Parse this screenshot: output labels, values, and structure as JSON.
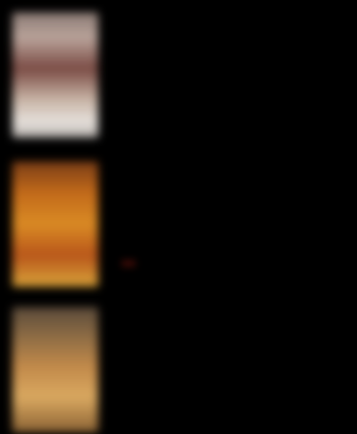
{
  "items": [
    {
      "title": "",
      "subtitle": "",
      "badge": "",
      "meta": ""
    },
    {
      "title": "",
      "subtitle": "",
      "badge": "",
      "meta": ""
    },
    {
      "title": "",
      "subtitle": "",
      "badge": "",
      "meta": ""
    }
  ],
  "colors": {
    "background": "#000000",
    "badge_bg": "#3a0a06",
    "badge_text": "#7a1a12"
  }
}
